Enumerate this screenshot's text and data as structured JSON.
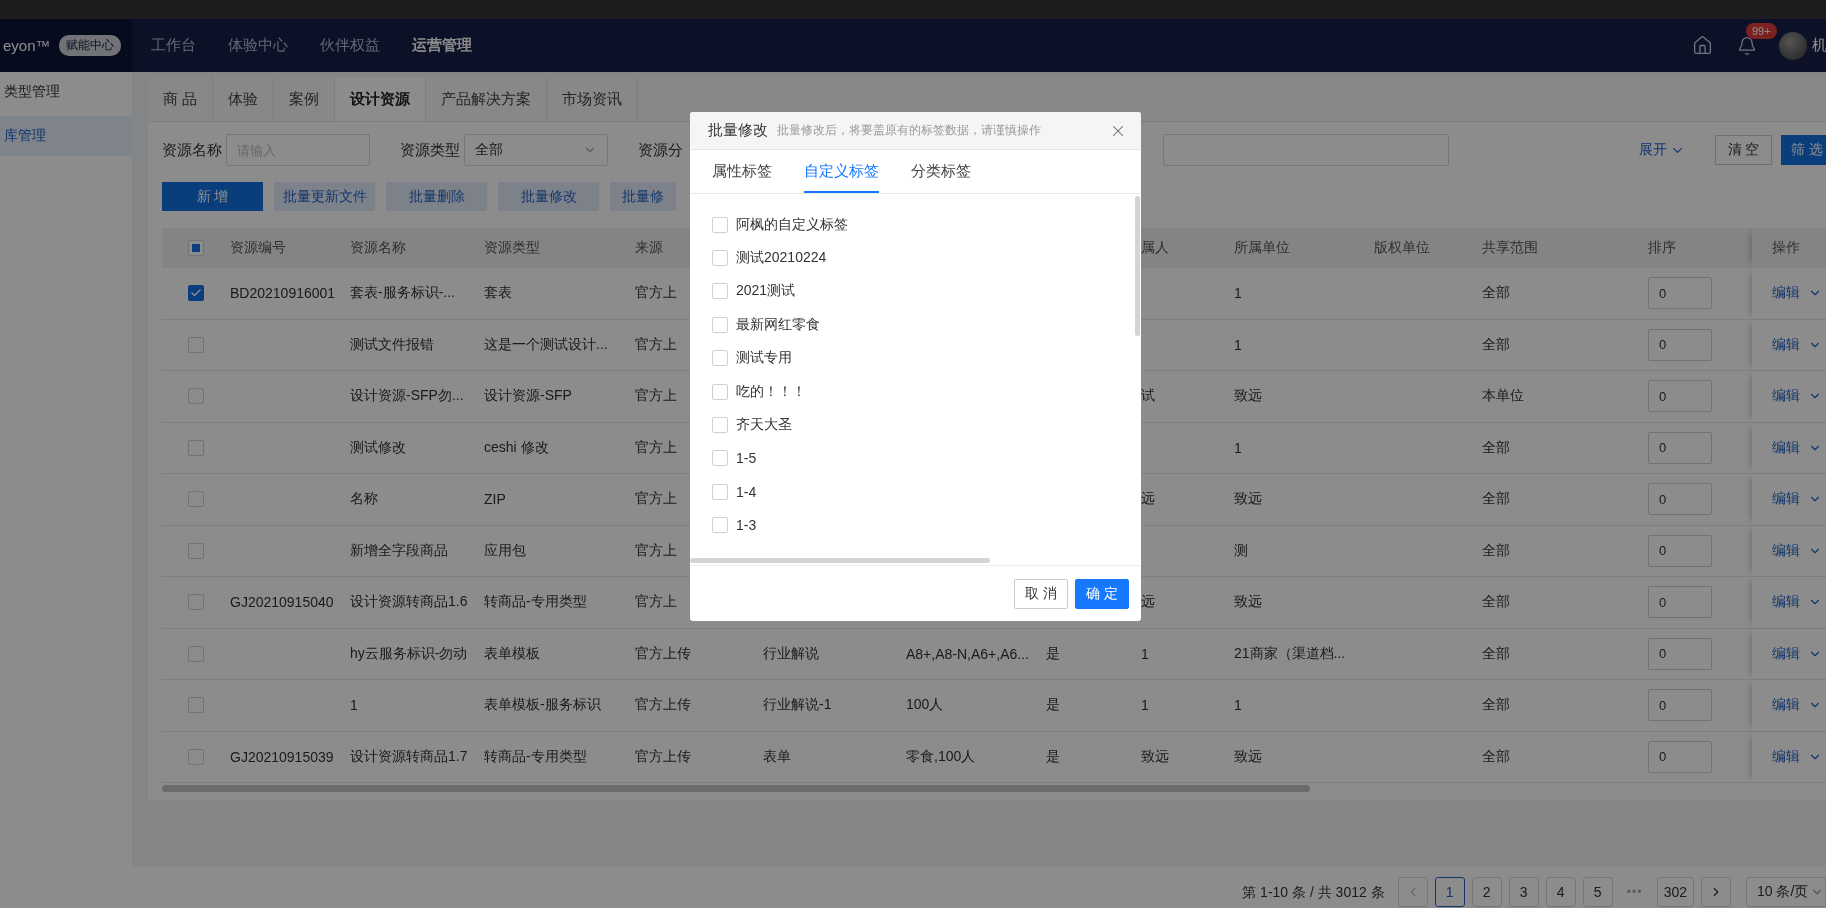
{
  "header": {
    "logo": "eyon™",
    "badge": "赋能中心",
    "nav": [
      {
        "label": "工作台",
        "selected": false
      },
      {
        "label": "体验中心",
        "selected": false
      },
      {
        "label": "伙伴权益",
        "selected": false
      },
      {
        "label": "运营管理",
        "selected": true
      }
    ],
    "notification_count": "99+",
    "user": "机"
  },
  "sidebar": {
    "items": [
      {
        "label": "类型管理",
        "selected": false
      },
      {
        "label": "库管理",
        "selected": true
      }
    ]
  },
  "tabs": [
    {
      "label": "商 品",
      "selected": false
    },
    {
      "label": "体验",
      "selected": false
    },
    {
      "label": "案例",
      "selected": false
    },
    {
      "label": "设计资源",
      "selected": true
    },
    {
      "label": "产品解决方案",
      "selected": false
    },
    {
      "label": "市场资讯",
      "selected": false
    }
  ],
  "filters": {
    "name_label": "资源名称",
    "name_placeholder": "请输入",
    "type_label": "资源类型",
    "type_value": "全部",
    "category_label": "资源分",
    "expand": "展开",
    "clear": "清 空",
    "search": "筛 选"
  },
  "toolbar": [
    {
      "label": "新 增",
      "kind": "primary"
    },
    {
      "label": "批量更新文件",
      "kind": "light"
    },
    {
      "label": "批量删除",
      "kind": "light"
    },
    {
      "label": "批量修改",
      "kind": "light"
    },
    {
      "label": "批量修",
      "kind": "light"
    }
  ],
  "table": {
    "select_all": {
      "indeterminate": true
    },
    "columns": [
      "资源编号",
      "资源名称",
      "资源类型",
      "来源",
      null,
      null,
      null,
      "属人",
      "所属单位",
      "版权单位",
      "共享范围",
      "排序",
      "操作"
    ],
    "rows": [
      {
        "selected": true,
        "cells": [
          "BD20210916001",
          "套表-服务标识-...",
          "套表",
          "官方上",
          null,
          null,
          null,
          null,
          "1",
          null,
          "全部"
        ],
        "sort": "0",
        "action": "编辑"
      },
      {
        "selected": false,
        "cells": [
          null,
          "测试文件报错",
          "这是一个测试设计...",
          "官方上",
          null,
          null,
          null,
          null,
          "1",
          null,
          "全部"
        ],
        "sort": "0",
        "action": "编辑"
      },
      {
        "selected": false,
        "cells": [
          null,
          "设计资源-SFP勿...",
          "设计资源-SFP",
          "官方上",
          null,
          null,
          null,
          "试",
          "致远",
          null,
          "本单位"
        ],
        "sort": "0",
        "action": "编辑"
      },
      {
        "selected": false,
        "cells": [
          null,
          "测试修改",
          "ceshi 修改",
          "官方上",
          null,
          null,
          null,
          null,
          "1",
          null,
          "全部"
        ],
        "sort": "0",
        "action": "编辑"
      },
      {
        "selected": false,
        "cells": [
          null,
          "名称",
          "ZIP",
          "官方上",
          null,
          null,
          null,
          "远",
          "致远",
          null,
          "全部"
        ],
        "sort": "0",
        "action": "编辑"
      },
      {
        "selected": false,
        "cells": [
          null,
          "新增全字段商品",
          "应用包",
          "官方上",
          null,
          null,
          null,
          null,
          "测",
          null,
          "全部"
        ],
        "sort": "0",
        "action": "编辑"
      },
      {
        "selected": false,
        "cells": [
          "GJ20210915040",
          "设计资源转商品1.6",
          "转商品-专用类型",
          "官方上",
          null,
          null,
          null,
          "远",
          "致远",
          null,
          "全部"
        ],
        "sort": "0",
        "action": "编辑"
      },
      {
        "selected": false,
        "cells": [
          null,
          "hy云服务标识-勿动",
          "表单模板",
          "官方上传",
          "行业解说",
          "A8+,A8-N,A6+,A6...",
          "是",
          "1",
          "21商家（渠道档...",
          null,
          "全部"
        ],
        "sort": "0",
        "action": "编辑"
      },
      {
        "selected": false,
        "cells": [
          null,
          "1",
          "表单模板-服务标识",
          "官方上传",
          "行业解说-1",
          "100人",
          "是",
          "1",
          "1",
          null,
          "全部"
        ],
        "sort": "0",
        "action": "编辑"
      },
      {
        "selected": false,
        "cells": [
          "GJ20210915039",
          "设计资源转商品1.7",
          "转商品-专用类型",
          "官方上传",
          "表单",
          "零食,100人",
          "是",
          "致远",
          "致远",
          null,
          "全部"
        ],
        "sort": "0",
        "action": "编辑"
      }
    ]
  },
  "pagination": {
    "summary": "第 1-10 条 / 共 3012 条",
    "prev": {
      "disabled": true
    },
    "next": {
      "disabled": false
    },
    "items": [
      {
        "kind": "page",
        "label": "1",
        "selected": true
      },
      {
        "kind": "page",
        "label": "2",
        "selected": false
      },
      {
        "kind": "page",
        "label": "3",
        "selected": false
      },
      {
        "kind": "page",
        "label": "4",
        "selected": false
      },
      {
        "kind": "page",
        "label": "5",
        "selected": false
      },
      {
        "kind": "ellipsis",
        "label": "•••"
      },
      {
        "kind": "page",
        "label": "302",
        "selected": false
      }
    ],
    "page_size": "10 条/页"
  },
  "modal": {
    "title": "批量修改",
    "subtitle": "批量修改后，将要盖原有的标签数据，请谨慎操作",
    "tabs": [
      {
        "label": "属性标签",
        "selected": false
      },
      {
        "label": "自定义标签",
        "selected": true
      },
      {
        "label": "分类标签",
        "selected": false
      }
    ],
    "tags": [
      {
        "label": "阿枫的自定义标签",
        "checked": false
      },
      {
        "label": "测试20210224",
        "checked": false
      },
      {
        "label": "2021测试",
        "checked": false
      },
      {
        "label": "最新网红零食",
        "checked": false
      },
      {
        "label": "测试专用",
        "checked": false
      },
      {
        "label": "吃的！！！",
        "checked": false
      },
      {
        "label": "齐天大圣",
        "checked": false
      },
      {
        "label": "1-5",
        "checked": false
      },
      {
        "label": "1-4",
        "checked": false
      },
      {
        "label": "1-3",
        "checked": false
      }
    ],
    "cancel": "取 消",
    "ok": "确 定"
  }
}
